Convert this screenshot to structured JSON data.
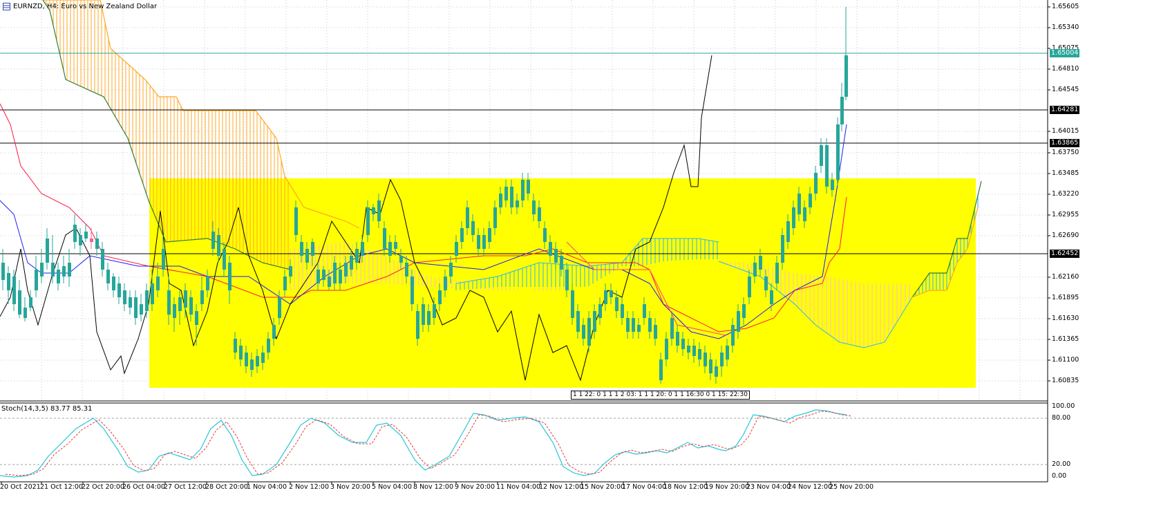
{
  "header": {
    "symbol": "EURNZD",
    "timeframe": "H4",
    "description": "Euro vs New Zealand Dollar",
    "title_text": "EURNZD, H4:  Euro vs New Zealand Dollar"
  },
  "indicator": {
    "label": "Stoch(14,3,5) 83.77 85.31",
    "main_value": 83.77,
    "signal_value": 85.31,
    "levels": [
      "100.00",
      "80.00",
      "20.00",
      "0.00"
    ]
  },
  "price_axis": {
    "labels": [
      "1.65605",
      "1.65340",
      "1.65075",
      "1.64810",
      "1.64545",
      "1.64015",
      "1.63750",
      "1.63485",
      "1.63220",
      "1.62955",
      "1.62690",
      "1.62160",
      "1.61895",
      "1.61630",
      "1.61365",
      "1.61100",
      "1.60835"
    ],
    "tags": [
      {
        "text": "1.65004",
        "style": "teal"
      },
      {
        "text": "1.64281",
        "style": "black"
      },
      {
        "text": "1.63865",
        "style": "black"
      },
      {
        "text": "1.62452",
        "style": "black"
      }
    ]
  },
  "time_axis": {
    "labels": [
      "20 Oct 2021",
      "21 Oct 12:00",
      "22 Oct 20:00",
      "26 Oct 04:00",
      "27 Oct 12:00",
      "28 Oct 20:00",
      "1 Nov 04:00",
      "2 Nov 12:00",
      "3 Nov 20:00",
      "5 Nov 04:00",
      "8 Nov 12:00",
      "9 Nov 20:00",
      "11 Nov 04:00",
      "12 Nov 12:00",
      "15 Nov 20:00",
      "17 Nov 04:00",
      "18 Nov 12:00",
      "19 Nov 20:00",
      "23 Nov 04:00",
      "24 Nov 12:00",
      "25 Nov 20:00"
    ]
  },
  "overlay_hint": "1 1 22: 0 1 1 1 2 03: 1 1 1 20: 0 1 1 16:30 0 1 15: 22:30",
  "colors": {
    "bull_candle": "#26a69a",
    "bear_candle": "#f06292",
    "zone": "#ffff00",
    "kumo_bear": "#ffa726",
    "kumo_bull": "#29b6f6",
    "stoch_main": "#26c6da",
    "stoch_signal": "#e53935"
  }
}
